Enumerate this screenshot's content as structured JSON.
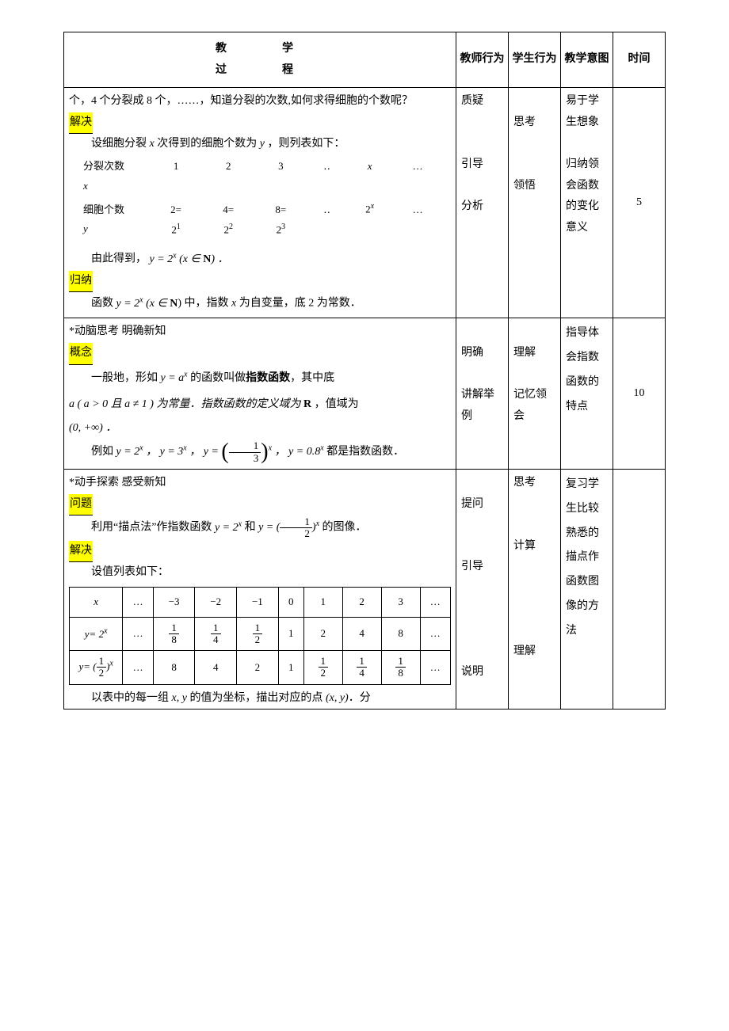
{
  "header": {
    "process": "教　　学\n过　　程",
    "teacher": "教师行为",
    "student": "学生行为",
    "intent": "教学意图",
    "time": "时间"
  },
  "row1": {
    "process": {
      "p1": "个，4 个分裂成 8 个，……，知道分裂的次数,如何求得细胞的个数呢？",
      "solve_label": "解决",
      "p2_prefix": "设细胞分裂",
      "p2_mid": "次得到的细胞个数为",
      "p2_suffix": "，则列表如下：",
      "tbl": {
        "r1_label": "分裂次数",
        "r1_var": "x",
        "r1_c1": "1",
        "r1_c2": "2",
        "r1_c3": "3",
        "r1_dots": "‥",
        "r1_cx": "x",
        "r1_end": "…",
        "r2_label": "细胞个数",
        "r2_var": "y",
        "r2_c1a": "2=",
        "r2_c1b_base": "2",
        "r2_c1b_exp": "1",
        "r2_c2a": "4=",
        "r2_c2b_base": "2",
        "r2_c2b_exp": "2",
        "r2_c3a": "8=",
        "r2_c3b_base": "2",
        "r2_c3b_exp": "3",
        "r2_dots": "‥",
        "r2_cx_base": "2",
        "r2_cx_exp": "x",
        "r2_end": "…"
      },
      "p3_a": "由此得到，",
      "p3_b": "y = 2",
      "p3_exp": "x",
      "p3_c": " (x ∈ ",
      "p3_N": "N",
      "p3_d": ") ．",
      "summary_label": "归纳",
      "p4_a": "函数 ",
      "p4_b": "y = 2",
      "p4_exp": "x",
      "p4_c": " (x ∈ ",
      "p4_N": "N",
      "p4_d": ") 中，指数 ",
      "p4_e": "x",
      "p4_f": " 为自变量，底 2 为常数．"
    },
    "teacher": "质疑\n\n\n引导\n\n分析",
    "student": "\n思考\n\n\n领悟",
    "intent": "易于学生想象\n\n归纳领会函数的变化意义",
    "time": "5"
  },
  "row2": {
    "title": "*动脑思考  明确新知",
    "concept_label": "概念",
    "p1_a": "一般地，形如 ",
    "p1_b": "y = a",
    "p1_exp": "x",
    "p1_c": " 的函数叫做",
    "p1_bold": "指数函数",
    "p1_d": "，其中底",
    "p2_a": "a",
    "p2_b": " ( a > 0 且  a ≠ 1 ) 为常量．指数函数的定义域为 ",
    "p2_R": "R",
    "p2_c": " ，值域为",
    "p3": "(0, +∞) ．",
    "p4_a": "例如 ",
    "p4_b": "y = 2",
    "p4_b_exp": "x",
    "p4_c": "， y = 3",
    "p4_c_exp": "x",
    "p4_d": "， y = ",
    "p4_frac_num": "1",
    "p4_frac_den": "3",
    "p4_d_exp": "x",
    "p4_e": "， y = 0.8",
    "p4_e_exp": "x",
    "p4_f": " 都是指数函数．",
    "teacher": "\n明确\n\n讲解举例",
    "student": "\n理解\n\n记忆领会",
    "intent": "指导体会指数函数的特点",
    "time": "10"
  },
  "row3": {
    "title": "*动手探索  感受新知",
    "q_label": "问题",
    "p1_a": "利用“描点法”作指数函数 ",
    "p1_b": "y = 2",
    "p1_b_exp": "x",
    "p1_c": " 和 ",
    "p1_d": "y = (",
    "p1_frac_num": "1",
    "p1_frac_den": "2",
    "p1_e": ")",
    "p1_e_exp": "x",
    "p1_f": " 的图像．",
    "solve_label": "解决",
    "p2": "设值列表如下：",
    "table": {
      "h_x": "x",
      "h_y1_a": "y= 2",
      "h_y1_exp": "x",
      "h_y2_a": "y= (",
      "h_y2_num": "1",
      "h_y2_den": "2",
      "h_y2_b": ")",
      "h_y2_exp": "x",
      "dots": "…",
      "x_vals": [
        "−3",
        "−2",
        "−1",
        "0",
        "1",
        "2",
        "3"
      ],
      "y1_vals": [
        {
          "num": "1",
          "den": "8"
        },
        {
          "num": "1",
          "den": "4"
        },
        {
          "num": "1",
          "den": "2"
        },
        "1",
        "2",
        "4",
        "8"
      ],
      "y2_vals": [
        "8",
        "4",
        "2",
        "1",
        {
          "num": "1",
          "den": "2"
        },
        {
          "num": "1",
          "den": "4"
        },
        {
          "num": "1",
          "den": "8"
        }
      ]
    },
    "p3_a": "以表中的每一组 ",
    "p3_b": "x, y",
    "p3_c": " 的值为坐标，描出对应的点 ",
    "p3_d": "(x, y)",
    "p3_e": "．分",
    "teacher": "\n提问\n\n\n引导\n\n\n\n\n说明",
    "student": "思考\n\n\n计算\n\n\n\n\n理解",
    "intent": "复习学生比较熟悉的描点作函数图像的方法",
    "time": ""
  },
  "chart_data": {
    "type": "table",
    "title": "指数函数描点法取值表",
    "columns": [
      "x",
      "y=2^x",
      "y=(1/2)^x"
    ],
    "rows": [
      [
        -3,
        0.125,
        8
      ],
      [
        -2,
        0.25,
        4
      ],
      [
        -1,
        0.5,
        2
      ],
      [
        0,
        1,
        1
      ],
      [
        1,
        2,
        0.5
      ],
      [
        2,
        4,
        0.25
      ],
      [
        3,
        8,
        0.125
      ]
    ]
  }
}
